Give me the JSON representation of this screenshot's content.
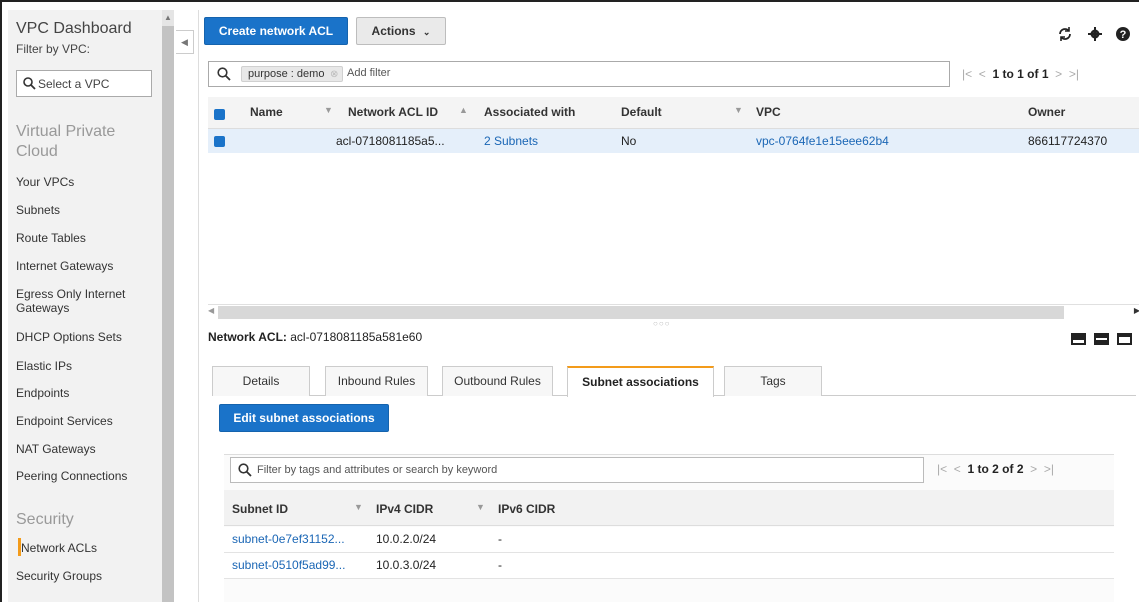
{
  "sidebar": {
    "title": "VPC Dashboard",
    "filter_label": "Filter by VPC:",
    "vpc_select_placeholder": "Select a VPC",
    "section_vpc": "Virtual Private Cloud",
    "vpc_items": [
      "Your VPCs",
      "Subnets",
      "Route Tables",
      "Internet Gateways",
      "Egress Only Internet Gateways",
      "DHCP Options Sets",
      "Elastic IPs",
      "Endpoints",
      "Endpoint Services",
      "NAT Gateways",
      "Peering Connections"
    ],
    "section_security": "Security",
    "security_items": [
      "Network ACLs",
      "Security Groups"
    ],
    "active_item": "Network ACLs"
  },
  "toolbar": {
    "create_label": "Create network ACL",
    "actions_label": "Actions"
  },
  "icons": {
    "refresh": "refresh-icon",
    "settings": "gear-icon",
    "help": "help-icon",
    "search": "search-icon"
  },
  "filter": {
    "chip": "purpose : demo",
    "add_filter_placeholder": "Add filter"
  },
  "main_pager": "1 to 1 of 1",
  "main_table": {
    "columns": [
      "Name",
      "Network ACL ID",
      "Associated with",
      "Default",
      "VPC",
      "Owner"
    ],
    "rows": [
      {
        "name": "",
        "acl_id": "acl-0718081185a5...",
        "associated": "2 Subnets",
        "default": "No",
        "vpc": "vpc-0764fe1e15eee62b4",
        "owner": "866117724370"
      }
    ]
  },
  "details": {
    "label": "Network ACL:",
    "acl_id": "acl-0718081185a581e60",
    "tabs": [
      "Details",
      "Inbound Rules",
      "Outbound Rules",
      "Subnet associations",
      "Tags"
    ],
    "active_tab": "Subnet associations",
    "edit_button": "Edit subnet associations",
    "search_placeholder": "Filter by tags and attributes or search by keyword",
    "pager": "1 to 2 of 2",
    "columns": [
      "Subnet ID",
      "IPv4 CIDR",
      "IPv6 CIDR"
    ],
    "rows": [
      {
        "subnet_id": "subnet-0e7ef31152...",
        "ipv4": "10.0.2.0/24",
        "ipv6": "-"
      },
      {
        "subnet_id": "subnet-0510f5ad99...",
        "ipv4": "10.0.3.0/24",
        "ipv6": "-"
      }
    ]
  },
  "colors": {
    "primary_button": "#1a73c9",
    "link": "#1a66b5",
    "active_accent": "#f39b1a",
    "selected_row": "#e5effa"
  }
}
